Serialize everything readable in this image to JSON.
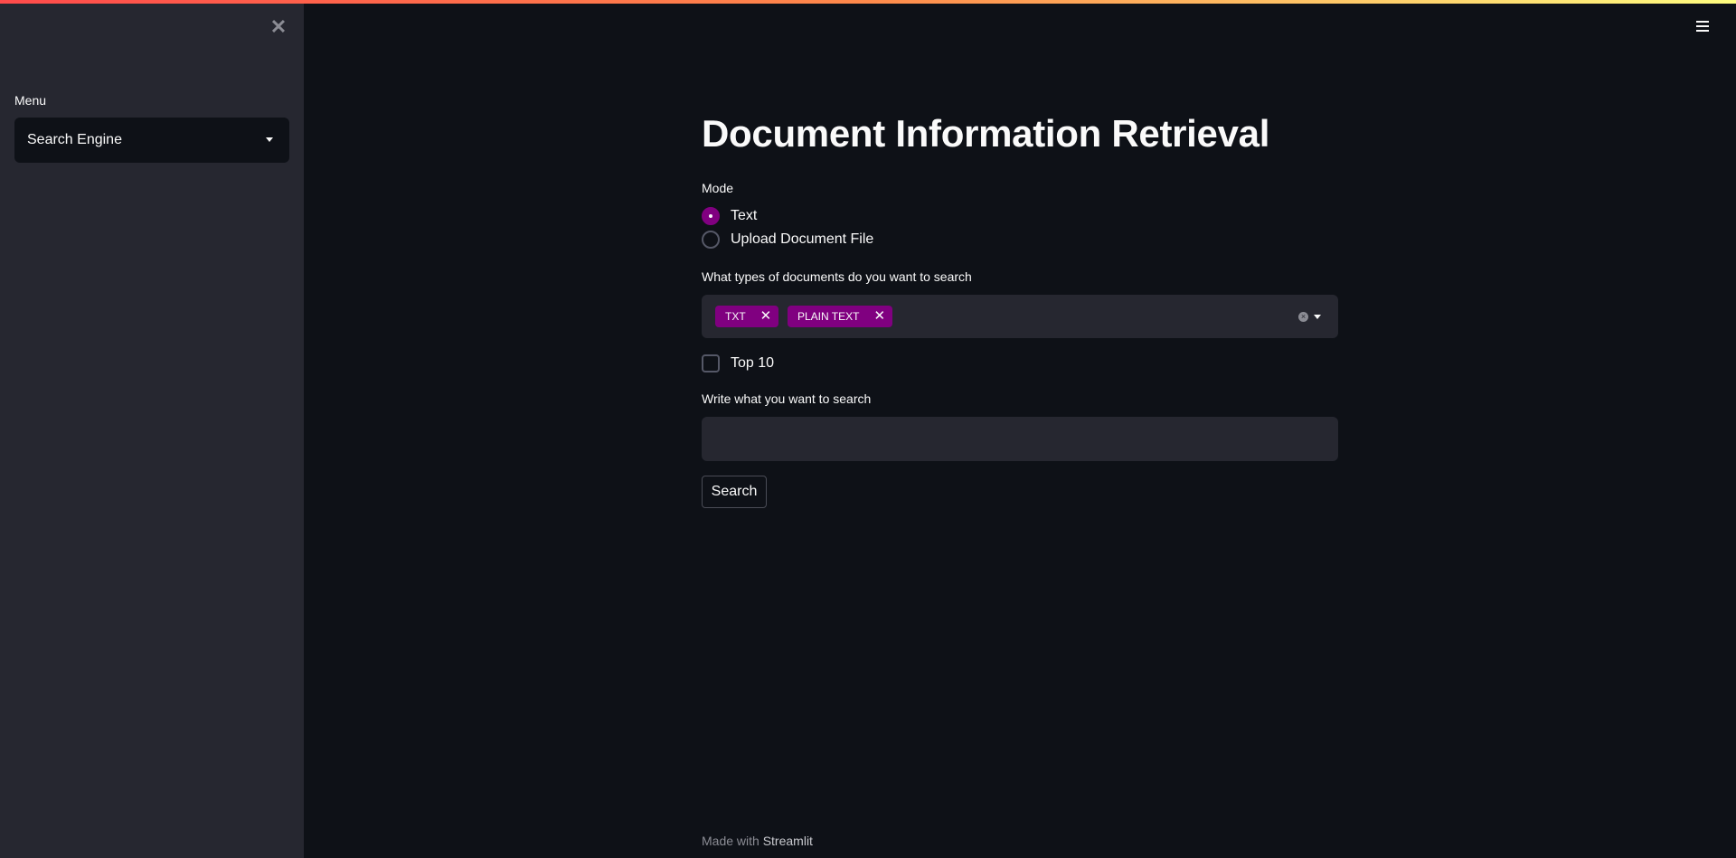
{
  "sidebar": {
    "close_glyph": "✕",
    "menu_label": "Menu",
    "menu_selected": "Search Engine"
  },
  "header": {
    "menu_icon": "hamburger-icon"
  },
  "main": {
    "title": "Document Information Retrieval",
    "mode": {
      "label": "Mode",
      "options": [
        {
          "label": "Text",
          "selected": true
        },
        {
          "label": "Upload Document File",
          "selected": false
        }
      ]
    },
    "doc_types": {
      "label": "What types of documents do you want to search",
      "tags": [
        "TXT",
        "PLAIN TEXT"
      ],
      "remove_glyph": "✕"
    },
    "top10": {
      "label": "Top 10",
      "checked": false
    },
    "query": {
      "label": "Write what you want to search",
      "value": ""
    },
    "search_button": "Search"
  },
  "footer": {
    "prefix": "Made with",
    "link": "Streamlit"
  },
  "colors": {
    "background": "#0e1117",
    "sidebar": "#262730",
    "accent": "#800080",
    "text": "#fafafa"
  }
}
